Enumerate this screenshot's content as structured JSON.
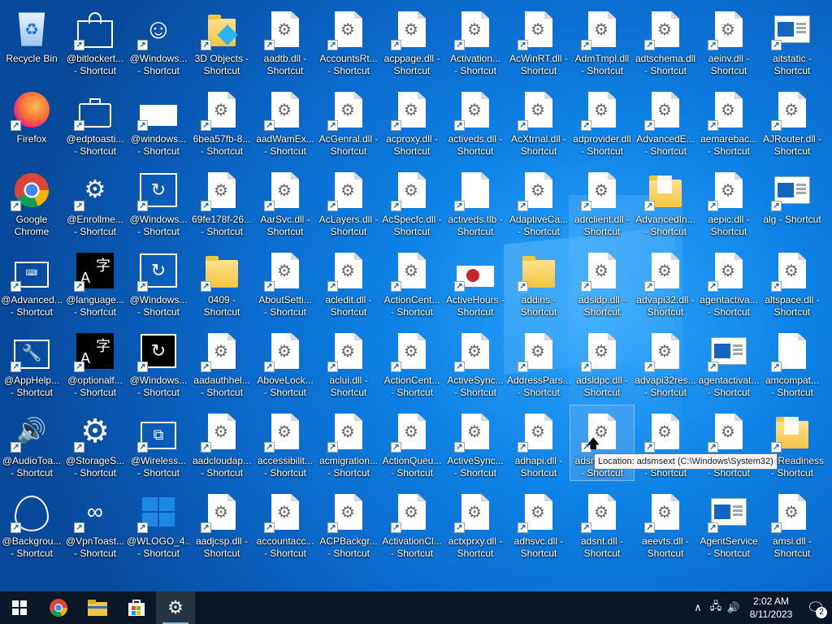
{
  "desktop": {
    "icons": [
      {
        "label": "Recycle Bin",
        "kind": "recycle",
        "shortcut": false
      },
      {
        "label": "@bitlockert...\n- Shortcut",
        "kind": "lock",
        "shortcut": true
      },
      {
        "label": "@Windows...\n- Shortcut",
        "kind": "smiley",
        "shortcut": true
      },
      {
        "label": "3D Objects -\nShortcut",
        "kind": "folder3d",
        "shortcut": true
      },
      {
        "label": "aadtb.dll -\nShortcut",
        "kind": "dll",
        "shortcut": true
      },
      {
        "label": "AccountsRt...\n- Shortcut",
        "kind": "dll",
        "shortcut": true
      },
      {
        "label": "acppage.dll -\nShortcut",
        "kind": "dll",
        "shortcut": true
      },
      {
        "label": "Activation...\n- Shortcut",
        "kind": "dll",
        "shortcut": true
      },
      {
        "label": "AcWinRT.dll -\nShortcut",
        "kind": "dll",
        "shortcut": true
      },
      {
        "label": "AdmTmpl.dll\n- Shortcut",
        "kind": "dll",
        "shortcut": true
      },
      {
        "label": "adtschema.dll\n- Shortcut",
        "kind": "dll",
        "shortcut": true
      },
      {
        "label": "aeinv.dll -\nShortcut",
        "kind": "dll",
        "shortcut": true
      },
      {
        "label": "aitstatic -\nShortcut",
        "kind": "window",
        "shortcut": true
      },
      {
        "label": "Firefox",
        "kind": "firefox",
        "shortcut": true
      },
      {
        "label": "@edptoasti...\n- Shortcut",
        "kind": "briefcase",
        "shortcut": true
      },
      {
        "label": "@windows...\n- Shortcut",
        "kind": "whitebox",
        "shortcut": true
      },
      {
        "label": "6bea57fb-8...\n- Shortcut",
        "kind": "dll",
        "shortcut": true
      },
      {
        "label": "aadWamEx...\n- Shortcut",
        "kind": "dll",
        "shortcut": true
      },
      {
        "label": "AcGenral.dll -\nShortcut",
        "kind": "dll",
        "shortcut": true
      },
      {
        "label": "acproxy.dll -\nShortcut",
        "kind": "dll",
        "shortcut": true
      },
      {
        "label": "activeds.dll -\nShortcut",
        "kind": "dll",
        "shortcut": true
      },
      {
        "label": "AcXtrnal.dll -\nShortcut",
        "kind": "dll",
        "shortcut": true
      },
      {
        "label": "adprovider.dll\n- Shortcut",
        "kind": "dll",
        "shortcut": true
      },
      {
        "label": "AdvancedE...\n- Shortcut",
        "kind": "dll",
        "shortcut": true
      },
      {
        "label": "aemarebac...\n- Shortcut",
        "kind": "dll",
        "shortcut": true
      },
      {
        "label": "AJRouter.dll -\nShortcut",
        "kind": "dll",
        "shortcut": true
      },
      {
        "label": "Google\nChrome",
        "kind": "chrome",
        "shortcut": true
      },
      {
        "label": "@Enrollme...\n- Shortcut",
        "kind": "gear",
        "shortcut": true
      },
      {
        "label": "@Windows...\n- Shortcut",
        "kind": "sync",
        "shortcut": true
      },
      {
        "label": "69fe178f-26...\n- Shortcut",
        "kind": "dll",
        "shortcut": true
      },
      {
        "label": "AarSvc.dll -\nShortcut",
        "kind": "dll",
        "shortcut": true
      },
      {
        "label": "AcLayers.dll -\nShortcut",
        "kind": "dll",
        "shortcut": true
      },
      {
        "label": "AcSpecfc.dll -\nShortcut",
        "kind": "dll",
        "shortcut": true
      },
      {
        "label": "activeds.tlb -\nShortcut",
        "kind": "blank",
        "shortcut": true
      },
      {
        "label": "AdaptiveCa...\n- Shortcut",
        "kind": "dll",
        "shortcut": true
      },
      {
        "label": "adrclient.dll -\nShortcut",
        "kind": "dll",
        "shortcut": true
      },
      {
        "label": "AdvancedIn...\n- Shortcut",
        "kind": "folderpage",
        "shortcut": true
      },
      {
        "label": "aepic.dll -\nShortcut",
        "kind": "dll",
        "shortcut": true
      },
      {
        "label": "alg - Shortcut",
        "kind": "window",
        "shortcut": true
      },
      {
        "label": "@Advanced...\n- Shortcut",
        "kind": "keyboard",
        "shortcut": true
      },
      {
        "label": "@language...\n- Shortcut",
        "kind": "langblack",
        "shortcut": true
      },
      {
        "label": "@Windows...\n- Shortcut",
        "kind": "sync",
        "shortcut": true
      },
      {
        "label": "0409 -\nShortcut",
        "kind": "folder",
        "shortcut": true
      },
      {
        "label": "AboutSetti...\n- Shortcut",
        "kind": "dll",
        "shortcut": true
      },
      {
        "label": "acledit.dll -\nShortcut",
        "kind": "dll",
        "shortcut": true
      },
      {
        "label": "ActionCent...\n- Shortcut",
        "kind": "dll",
        "shortcut": true
      },
      {
        "label": "ActiveHours -\nShortcut",
        "kind": "activehours",
        "shortcut": true
      },
      {
        "label": "addins -\nShortcut",
        "kind": "folder",
        "shortcut": true
      },
      {
        "label": "adsldp.dll -\nShortcut",
        "kind": "dll",
        "shortcut": true
      },
      {
        "label": "advapi32.dll -\nShortcut",
        "kind": "dll",
        "shortcut": true
      },
      {
        "label": "agentactiva...\n- Shortcut",
        "kind": "dll",
        "shortcut": true
      },
      {
        "label": "altspace.dll -\nShortcut",
        "kind": "dll",
        "shortcut": true
      },
      {
        "label": "@AppHelp...\n- Shortcut",
        "kind": "wrench",
        "shortcut": true
      },
      {
        "label": "@optionalf...\n- Shortcut",
        "kind": "langblack",
        "shortcut": true
      },
      {
        "label": "@Windows...\n- Shortcut",
        "kind": "syncdark",
        "shortcut": true
      },
      {
        "label": "aadauthhel...\n- Shortcut",
        "kind": "dll",
        "shortcut": true
      },
      {
        "label": "AboveLock...\n- Shortcut",
        "kind": "dll",
        "shortcut": true
      },
      {
        "label": "aclui.dll -\nShortcut",
        "kind": "dll",
        "shortcut": true
      },
      {
        "label": "ActionCent...\n- Shortcut",
        "kind": "dll",
        "shortcut": true
      },
      {
        "label": "ActiveSync...\n- Shortcut",
        "kind": "dll",
        "shortcut": true
      },
      {
        "label": "AddressPars...\n- Shortcut",
        "kind": "dll",
        "shortcut": true
      },
      {
        "label": "adsldpc.dll -\nShortcut",
        "kind": "dll",
        "shortcut": true
      },
      {
        "label": "advapi32res...\n- Shortcut",
        "kind": "dll",
        "shortcut": true
      },
      {
        "label": "agentactivat...\n- Shortcut",
        "kind": "window",
        "shortcut": true
      },
      {
        "label": "amcompat...\n- Shortcut",
        "kind": "blank",
        "shortcut": true
      },
      {
        "label": "@AudioToa...\n- Shortcut",
        "kind": "speaker",
        "shortcut": true
      },
      {
        "label": "@StorageS...\n- Shortcut",
        "kind": "biggear",
        "shortcut": true
      },
      {
        "label": "@Wireless...\n- Shortcut",
        "kind": "cast",
        "shortcut": true
      },
      {
        "label": "aadcloudap...\n- Shortcut",
        "kind": "dll",
        "shortcut": true
      },
      {
        "label": "accessibilit...\n- Shortcut",
        "kind": "dll",
        "shortcut": true
      },
      {
        "label": "acmigration...\n- Shortcut",
        "kind": "dll",
        "shortcut": true
      },
      {
        "label": "ActionQueu...\n- Shortcut",
        "kind": "dll",
        "shortcut": true
      },
      {
        "label": "ActiveSync...\n- Shortcut",
        "kind": "dll",
        "shortcut": true
      },
      {
        "label": "adhapi.dll -\nShortcut",
        "kind": "dll",
        "shortcut": true
      },
      {
        "label": "adsmsext.dll\n- Shortcut",
        "kind": "dll",
        "shortcut": true,
        "selected": true
      },
      {
        "label": "adtschema...\n- Shortcut",
        "kind": "dll",
        "shortcut": true
      },
      {
        "label": "adv...\n- Shortcut",
        "kind": "dll",
        "shortcut": true
      },
      {
        "label": "AppReadiness...\n- Shortcut",
        "kind": "folderpage",
        "shortcut": true
      },
      {
        "label": "@Backgrou...\n- Shortcut",
        "kind": "leaf",
        "shortcut": true
      },
      {
        "label": "@VpnToast...\n- Shortcut",
        "kind": "vpn",
        "shortcut": true
      },
      {
        "label": "@WLOGO_4...\n- Shortcut",
        "kind": "winlogo",
        "shortcut": true
      },
      {
        "label": "aadjcsp.dll -\nShortcut",
        "kind": "dll",
        "shortcut": true
      },
      {
        "label": "accountacc...\n- Shortcut",
        "kind": "dll",
        "shortcut": true
      },
      {
        "label": "ACPBackgr...\n- Shortcut",
        "kind": "dll",
        "shortcut": true
      },
      {
        "label": "ActivationCl...\n- Shortcut",
        "kind": "dll",
        "shortcut": true
      },
      {
        "label": "actxprxy.dll -\nShortcut",
        "kind": "dll",
        "shortcut": true
      },
      {
        "label": "adhsvc.dll -\nShortcut",
        "kind": "dll",
        "shortcut": true
      },
      {
        "label": "adsnt.dll -\nShortcut",
        "kind": "dll",
        "shortcut": true
      },
      {
        "label": "aeevts.dll -\nShortcut",
        "kind": "dll",
        "shortcut": true
      },
      {
        "label": "AgentService\n- Shortcut",
        "kind": "window",
        "shortcut": true
      },
      {
        "label": "amsi.dll -\nShortcut",
        "kind": "dll",
        "shortcut": true
      }
    ]
  },
  "tooltip": {
    "text": "Location: adsmsext (C:\\Windows\\System32)"
  },
  "taskbar": {
    "apps": [
      {
        "name": "start",
        "icon": "windows-icon"
      },
      {
        "name": "chrome",
        "icon": "chrome-icon"
      },
      {
        "name": "explorer",
        "icon": "folder-icon"
      },
      {
        "name": "store",
        "icon": "store-icon"
      },
      {
        "name": "settings",
        "icon": "gear-icon",
        "active": true
      }
    ],
    "clock": {
      "time": "2:02 AM",
      "date": "8/11/2023"
    },
    "notifications": {
      "count": "2"
    }
  },
  "colors": {
    "accent": "#0b67c9",
    "taskbar": "#0b1726",
    "tooltip_bg": "#f5f5f5"
  }
}
